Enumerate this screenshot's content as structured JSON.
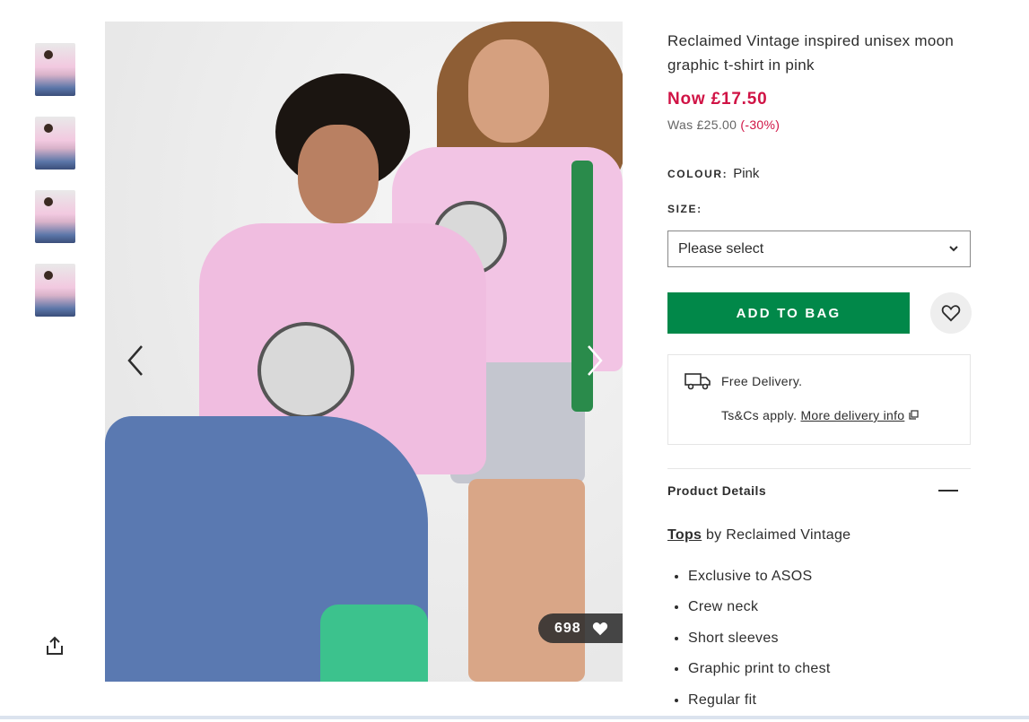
{
  "gallery": {
    "thumbnails": [
      "thumb-1",
      "thumb-2",
      "thumb-3",
      "thumb-4"
    ],
    "likes_count": "698",
    "icons": {
      "share": "share-icon",
      "prev": "chevron-left-icon",
      "next": "chevron-right-icon",
      "heart": "heart-icon"
    }
  },
  "product": {
    "title": "Reclaimed Vintage inspired unisex moon graphic t-shirt in pink",
    "price_now": "Now £17.50",
    "price_was": "Was £25.00",
    "discount": "(-30%)",
    "colour_label": "COLOUR:",
    "colour_value": "Pink",
    "size_label": "SIZE:",
    "size_placeholder": "Please select",
    "add_to_bag": "ADD TO BAG"
  },
  "delivery": {
    "free": "Free Delivery.",
    "tcs": "Ts&Cs apply.",
    "link": "More delivery info"
  },
  "product_details": {
    "heading": "Product Details",
    "category_link": "Tops",
    "category_rest": "by Reclaimed Vintage",
    "bullets": [
      "Exclusive to ASOS",
      "Crew neck",
      "Short sleeves",
      "Graphic print to chest",
      "Regular fit"
    ]
  },
  "colors": {
    "accent_green": "#018849",
    "sale_red": "#d01345",
    "text": "#2d2d2d"
  }
}
